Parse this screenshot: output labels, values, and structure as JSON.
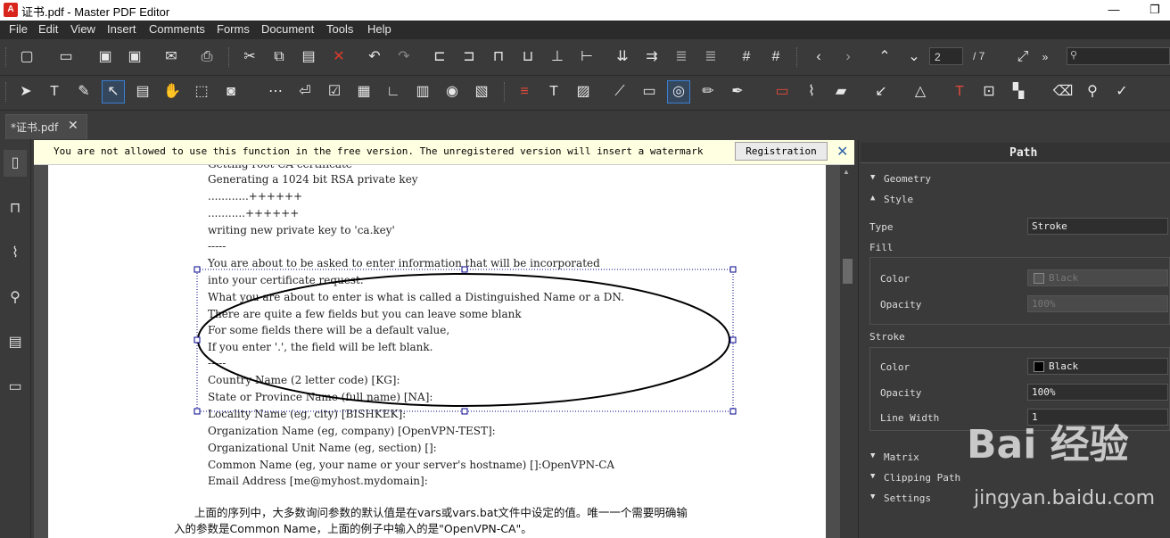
{
  "window": {
    "title": "证书.pdf - Master PDF Editor"
  },
  "menu": [
    "File",
    "Edit",
    "View",
    "Insert",
    "Comments",
    "Forms",
    "Document",
    "Tools",
    "Help"
  ],
  "navigation": {
    "page_current": "2",
    "page_total": "/ 7"
  },
  "tab": {
    "label": "*证书.pdf",
    "close": "✕"
  },
  "notice": {
    "message": "You are not allowed to use this function in the free version.  The unregistered version will insert a watermark",
    "button": "Registration",
    "close": "✕"
  },
  "document": {
    "lines": [
      "Generating a 1024 bit RSA private key",
      "............++++++",
      "...........++++++",
      "writing new private key to 'ca.key'",
      "-----",
      "You are about to be asked to enter information that will be incorporated",
      "into your certificate request.",
      "What you are about to enter is what is called a Distinguished Name or a DN.",
      "There are quite a few fields but you can leave some blank",
      "For some fields there will be a default value,",
      "If you enter '.', the field will be left blank.",
      "-----",
      "Country Name (2 letter code) [KG]:",
      "State or Province Name (full name) [NA]:",
      "Locality Name (eg, city) [BISHKEK]:",
      "Organization Name (eg, company) [OpenVPN-TEST]:",
      "Organizational Unit Name (eg, section) []:",
      "Common Name (eg, your name or your server's hostname) []:OpenVPN-CA",
      "Email Address [me@myhost.mydomain]:"
    ],
    "paragraph_line1": "上面的序列中，大多数询问参数的默认值是在vars或vars.bat文件中设定的值。唯一一个需要明确输",
    "paragraph_line2": "入的参数是Common Name，上面的例子中输入的是\"OpenVPN-CA\"。"
  },
  "panel": {
    "title": "Path",
    "geometry": "Geometry",
    "style": "Style",
    "type_label": "Type",
    "type_value": "Stroke",
    "fill_label": "Fill",
    "fill_color_label": "Color",
    "fill_color_value": "Black",
    "fill_opacity_label": "Opacity",
    "fill_opacity_value": "100%",
    "stroke_label": "Stroke",
    "stroke_color_label": "Color",
    "stroke_color_value": "Black",
    "stroke_opacity_label": "Opacity",
    "stroke_opacity_value": "100%",
    "line_width_label": "Line Width",
    "line_width_value": "1",
    "matrix": "Matrix",
    "clipping_path": "Clipping Path",
    "settings": "Settings"
  },
  "watermark": {
    "text": "Bai 经验",
    "sub": "jingyan.baidu.com"
  },
  "colors": {
    "accent": "#3b7fd4",
    "selection": "#00008b",
    "notice_bg": "#ffffe1"
  }
}
